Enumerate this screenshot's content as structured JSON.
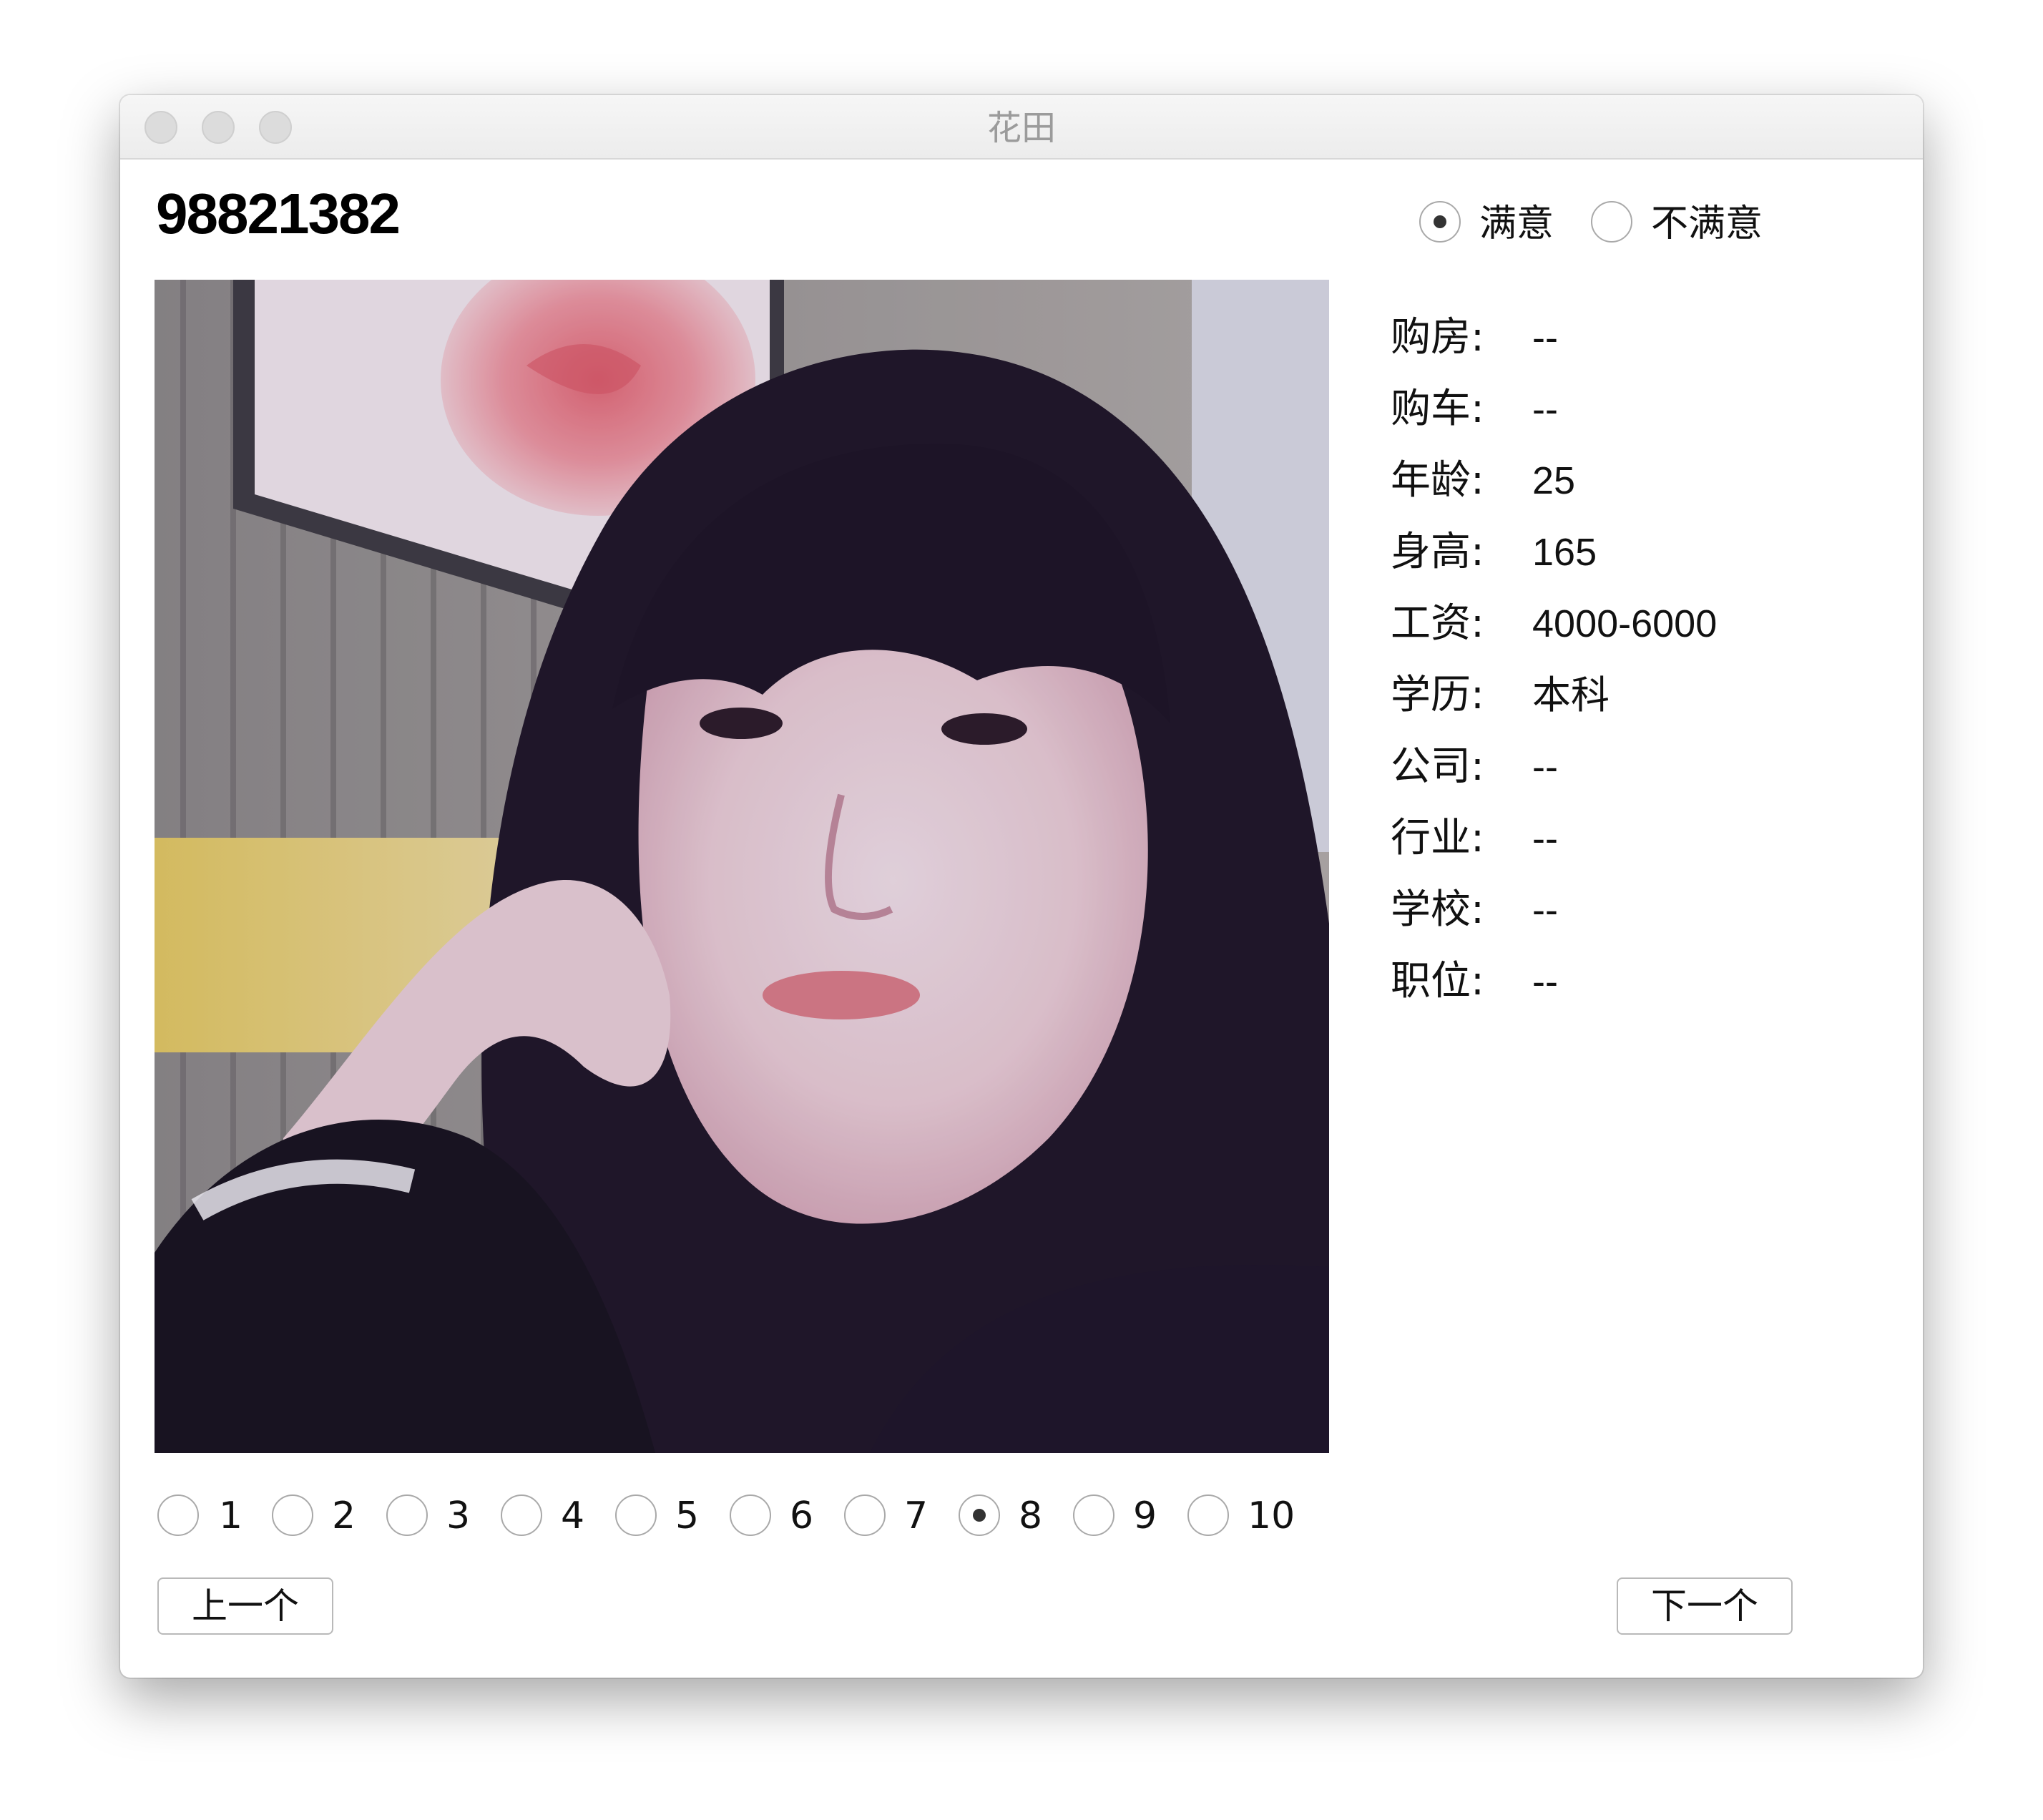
{
  "window": {
    "title": "花田"
  },
  "profile": {
    "id": "98821382"
  },
  "satisfaction": {
    "options": [
      {
        "label": "满意",
        "checked": true
      },
      {
        "label": "不满意",
        "checked": false
      }
    ]
  },
  "details": [
    {
      "key": "购房:",
      "value": "--"
    },
    {
      "key": "购车:",
      "value": "--"
    },
    {
      "key": "年龄:",
      "value": "25"
    },
    {
      "key": "身高:",
      "value": "165"
    },
    {
      "key": "工资:",
      "value": "4000-6000"
    },
    {
      "key": "学历:",
      "value": "本科"
    },
    {
      "key": "公司:",
      "value": "--"
    },
    {
      "key": "行业:",
      "value": "--"
    },
    {
      "key": "学校:",
      "value": "--"
    },
    {
      "key": "职位:",
      "value": "--"
    }
  ],
  "rating": {
    "options": [
      "1",
      "2",
      "3",
      "4",
      "5",
      "6",
      "7",
      "8",
      "9",
      "10"
    ],
    "selected": "8"
  },
  "nav": {
    "prev_label": "上一个",
    "next_label": "下一个"
  }
}
